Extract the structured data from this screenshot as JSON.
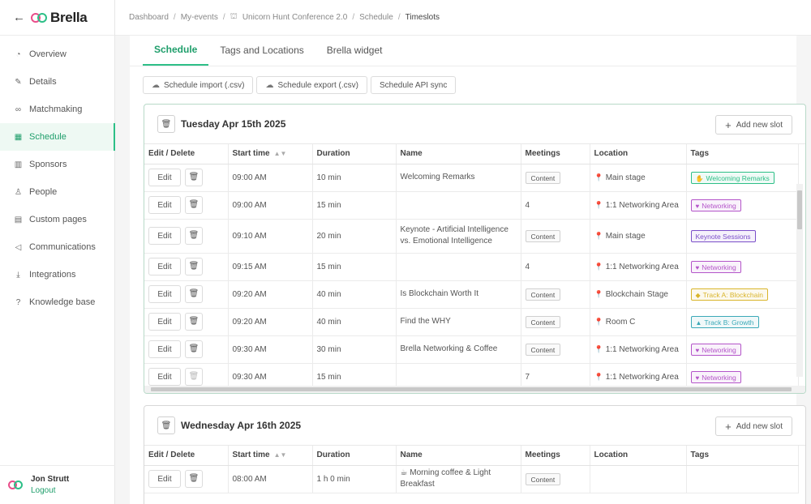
{
  "app": {
    "brand_name": "Brella",
    "colors": {
      "accent": "#2dbf87",
      "accent_dark": "#1f9e6b",
      "brand_pink": "#e94d8a"
    }
  },
  "sidebar": {
    "items": [
      {
        "label": "Overview",
        "icon": "overview-icon",
        "glyph": "◔"
      },
      {
        "label": "Details",
        "icon": "edit-icon",
        "glyph": "✎"
      },
      {
        "label": "Matchmaking",
        "icon": "link-icon",
        "glyph": "∞"
      },
      {
        "label": "Schedule",
        "icon": "calendar-icon",
        "glyph": "▦"
      },
      {
        "label": "Sponsors",
        "icon": "grid-icon",
        "glyph": "▥"
      },
      {
        "label": "People",
        "icon": "people-icon",
        "glyph": "♙"
      },
      {
        "label": "Custom pages",
        "icon": "page-icon",
        "glyph": "▤"
      },
      {
        "label": "Communications",
        "icon": "megaphone-icon",
        "glyph": "◁"
      },
      {
        "label": "Integrations",
        "icon": "download-icon",
        "glyph": "⤓"
      },
      {
        "label": "Knowledge base",
        "icon": "help-icon",
        "glyph": "?"
      }
    ],
    "active_index": 3,
    "user": {
      "name": "Jon Strutt",
      "logout_label": "Logout"
    }
  },
  "breadcrumb": [
    "Dashboard",
    "My-events",
    "Unicorn Hunt Conference 2.0",
    "Schedule",
    "Timeslots"
  ],
  "tabs": [
    "Schedule",
    "Tags and Locations",
    "Brella widget"
  ],
  "active_tab": 0,
  "toolbar": {
    "import_label": "Schedule import (.csv)",
    "export_label": "Schedule export (.csv)",
    "api_label": "Schedule API sync"
  },
  "table": {
    "columns": [
      "Edit / Delete",
      "Start time",
      "Duration",
      "Name",
      "Meetings",
      "Location",
      "Tags"
    ],
    "edit_label": "Edit",
    "add_slot_label": "Add new slot"
  },
  "days": [
    {
      "title": "Tuesday Apr 15th 2025",
      "rows": [
        {
          "time": "09:00 AM",
          "duration": "10 min",
          "name": "Welcoming Remarks",
          "meetings": "Content",
          "meetings_badge": true,
          "location": "Main stage",
          "tag": "Welcoming Remarks",
          "tag_icon": "✋",
          "tag_color": "#2dbf87"
        },
        {
          "time": "09:00 AM",
          "duration": "15 min",
          "name": "",
          "meetings": "4",
          "meetings_badge": false,
          "location": "1:1 Networking Area",
          "tag": "Networking",
          "tag_icon": "♥",
          "tag_color": "#b455c9"
        },
        {
          "time": "09:10 AM",
          "duration": "20 min",
          "name": "Keynote - Artificial Intelligence vs. Emotional Intelligence",
          "meetings": "Content",
          "meetings_badge": true,
          "location": "Main stage",
          "tag": "Keynote Sessions",
          "tag_icon": "",
          "tag_color": "#7b4fc9"
        },
        {
          "time": "09:15 AM",
          "duration": "15 min",
          "name": "",
          "meetings": "4",
          "meetings_badge": false,
          "location": "1:1 Networking Area",
          "tag": "Networking",
          "tag_icon": "♥",
          "tag_color": "#b455c9"
        },
        {
          "time": "09:20 AM",
          "duration": "40 min",
          "name": "Is Blockchain Worth It",
          "meetings": "Content",
          "meetings_badge": true,
          "location": "Blockchain Stage",
          "tag": "Track A: Blockchain",
          "tag_icon": "◆",
          "tag_color": "#d9b52c"
        },
        {
          "time": "09:20 AM",
          "duration": "40 min",
          "name": "Find the WHY",
          "meetings": "Content",
          "meetings_badge": true,
          "location": "Room C",
          "tag": "Track B: Growth",
          "tag_icon": "▲",
          "tag_color": "#3ba9b8"
        },
        {
          "time": "09:30 AM",
          "duration": "30 min",
          "name": "Brella Networking & Coffee",
          "meetings": "Content",
          "meetings_badge": true,
          "location": "1:1 Networking Area",
          "tag": "Networking",
          "tag_icon": "♥",
          "tag_color": "#b455c9"
        },
        {
          "time": "09:30 AM",
          "duration": "15 min",
          "name": "",
          "meetings": "7",
          "meetings_badge": false,
          "location": "1:1 Networking Area",
          "tag": "Networking",
          "tag_icon": "♥",
          "tag_color": "#b455c9"
        }
      ]
    },
    {
      "title": "Wednesday Apr 16th 2025",
      "rows": [
        {
          "time": "08:00 AM",
          "duration": "1 h 0 min",
          "name": "Morning coffee & Light Breakfast",
          "name_icon": "☕",
          "meetings": "Content",
          "meetings_badge": true,
          "location": "",
          "tag": "",
          "tag_icon": "",
          "tag_color": ""
        }
      ]
    }
  ]
}
